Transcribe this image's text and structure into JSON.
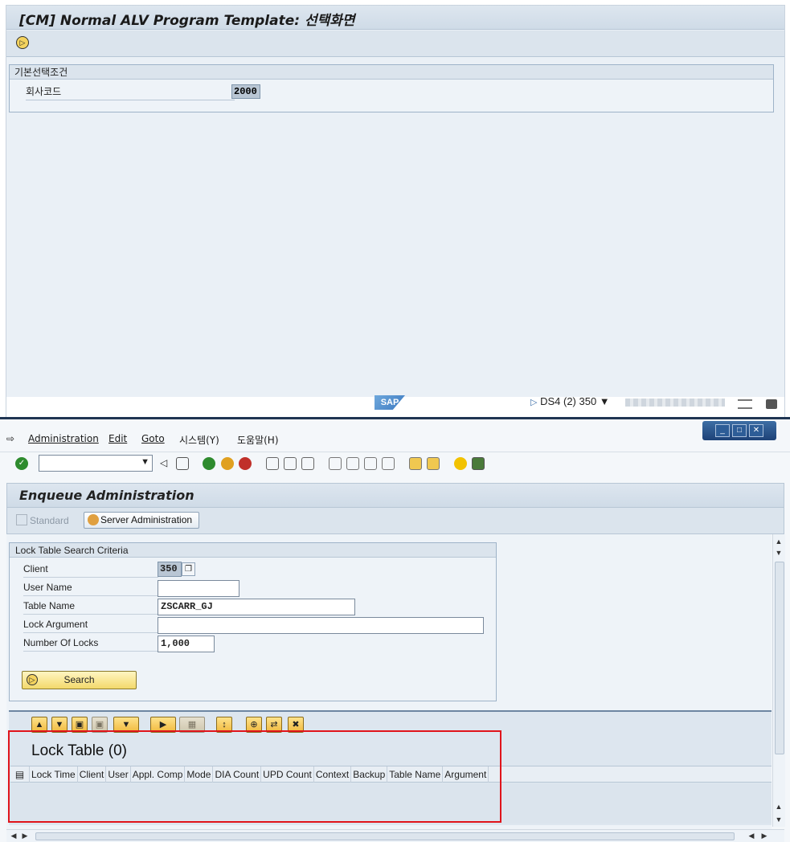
{
  "top_window": {
    "title": "[CM] Normal ALV Program Template: 선택화면",
    "group_title": "기본선택조건",
    "field_label": "회사코드",
    "field_value": "2000",
    "status": {
      "logo": "SAP",
      "system": "DS4 (2) 350 ▼"
    }
  },
  "bottom_window": {
    "menu": [
      "Administration",
      "Edit",
      "Goto",
      "시스템(Y)",
      "도움말(H)"
    ],
    "command_field_value": "",
    "title": "Enqueue Administration",
    "app_toolbar": {
      "standard_label": "Standard",
      "server_admin_label": "Server Administration"
    },
    "criteria": {
      "title": "Lock Table Search Criteria",
      "fields": [
        {
          "label": "Client",
          "value": "350"
        },
        {
          "label": "User Name",
          "value": ""
        },
        {
          "label": "Table Name",
          "value": "ZSCARR_GJ"
        },
        {
          "label": "Lock Argument",
          "value": ""
        },
        {
          "label": "Number Of Locks",
          "value": "1,000"
        }
      ],
      "search_label": "Search"
    },
    "alv": {
      "title": "Lock Table (0)",
      "columns": [
        "Lock Time",
        "Client",
        "User",
        "Appl. Comp",
        "Mode",
        "DIA Count",
        "UPD Count",
        "Context",
        "Backup",
        "Table Name",
        "Argument"
      ],
      "rows": []
    }
  },
  "colors": {
    "highlight_border": "#e0141b",
    "title_bar": "#dde6ef",
    "window_controls": "#2d5d97"
  }
}
